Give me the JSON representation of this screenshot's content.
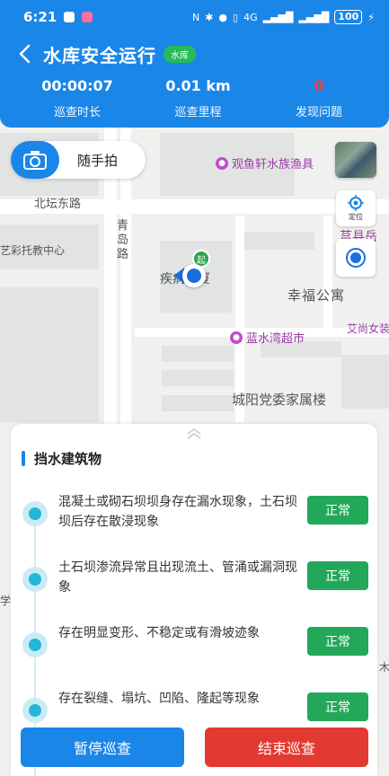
{
  "status_bar": {
    "time": "6:21",
    "network": "4G",
    "battery": "100"
  },
  "header": {
    "title": "水库安全运行",
    "tag": "水库"
  },
  "stats": [
    {
      "value": "00:00:07",
      "label": "巡查时长"
    },
    {
      "value": "0.01 km",
      "label": "巡查里程"
    },
    {
      "value": "0",
      "label": "发现问题",
      "color": "#ff3b3b"
    }
  ],
  "map": {
    "snap_button": "随手拍",
    "locate_label": "定位",
    "start_marker": "起",
    "labels": {
      "road1": "北坛东路",
      "road2": "青岛路",
      "place1": "艺彩托教中心",
      "place2": "莒县岳",
      "place3": "疾病大厦",
      "place4": "幸福公寓",
      "place5": "艾尚女装",
      "place6": "城阳党委家属楼",
      "poi1": "观鱼轩水族渔具",
      "poi2": "蓝水湾超市",
      "edge1": "学",
      "edge2": "木"
    }
  },
  "panel": {
    "section_title": "挡水建筑物",
    "items": [
      {
        "text": "混凝土或砌石坝坝身存在漏水现象，土石坝坝后存在散浸现象",
        "status": "正常"
      },
      {
        "text": "土石坝渗流异常且出现流土、管涌或漏洞现象",
        "status": "正常"
      },
      {
        "text": "存在明显变形、不稳定或有滑坡迹象",
        "status": "正常"
      },
      {
        "text": "存在裂缝、塌坑、凹陷、隆起等现象",
        "status": "正常"
      }
    ]
  },
  "footer": {
    "pause": "暂停巡查",
    "end": "结束巡查"
  },
  "colors": {
    "primary": "#1a86e8",
    "success": "#23a85a",
    "danger": "#e23a32"
  }
}
